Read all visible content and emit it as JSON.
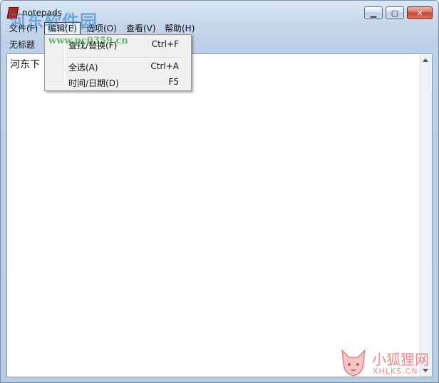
{
  "window": {
    "title": "notepads"
  },
  "titlebar_buttons": {
    "minimize_icon": "minimize-icon",
    "maximize_icon": "maximize-icon",
    "close_icon": "close-icon"
  },
  "menubar": {
    "items": [
      {
        "label": "文件(F)"
      },
      {
        "label": "编辑(E)",
        "active": true
      },
      {
        "label": "选项(O)"
      },
      {
        "label": "查看(V)"
      },
      {
        "label": "帮助(H)"
      }
    ]
  },
  "tabs": [
    {
      "label": "无标题"
    }
  ],
  "editor": {
    "content": "河东下"
  },
  "edit_menu": {
    "items": [
      {
        "label": "查找/替换(F)",
        "shortcut": "Ctrl+F"
      },
      {
        "label": "全选(A)",
        "shortcut": "Ctrl+A"
      },
      {
        "label": "时间/日期(D)",
        "shortcut": "F5"
      }
    ]
  },
  "watermarks": {
    "top_text": "河东软件园",
    "top_url": "www.pc0359.cn",
    "bottom_text": "小狐狸网",
    "bottom_url": "XHLKS.CN"
  }
}
